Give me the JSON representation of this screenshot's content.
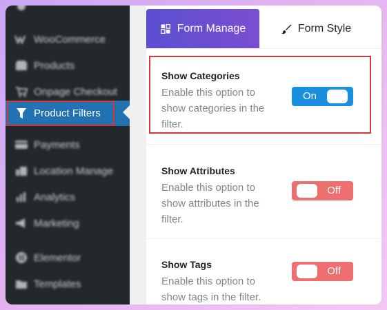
{
  "colors": {
    "frame_gradient_start": "#c9a7f5",
    "frame_gradient_end": "#f3c8f4",
    "sidebar_bg": "#23282d",
    "active_menu_bg": "#2271b1",
    "highlight_outline": "#d63638",
    "tab_active_start": "#5b4fd1",
    "tab_active_end": "#7a4fd0",
    "toggle_on": "#1a8fe0",
    "toggle_off": "#ee6f6f"
  },
  "sidebar": {
    "items": [
      {
        "label": "WooCommerce",
        "icon": "woocommerce-icon"
      },
      {
        "label": "Products",
        "icon": "box-icon"
      },
      {
        "label": "Onpage Checkout",
        "icon": "cart-icon"
      },
      {
        "label": "Product Filters",
        "icon": "filter-icon",
        "active": true
      },
      {
        "label": "Payments",
        "icon": "card-icon"
      },
      {
        "label": "Location Manage",
        "icon": "location-icon"
      },
      {
        "label": "Analytics",
        "icon": "bar-chart-icon"
      },
      {
        "label": "Marketing",
        "icon": "megaphone-icon"
      },
      {
        "label": "Elementor",
        "icon": "elementor-icon"
      },
      {
        "label": "Templates",
        "icon": "folder-icon"
      }
    ]
  },
  "tabs": [
    {
      "label": "Form Manage",
      "icon": "grid-icon",
      "active": true
    },
    {
      "label": "Form Style",
      "icon": "brush-icon",
      "active": false
    }
  ],
  "settings": [
    {
      "title": "Show Categories",
      "description": "Enable this option to show categories in the filter.",
      "toggle": "On",
      "enabled": true
    },
    {
      "title": "Show Attributes",
      "description": "Enable this option to show attributes in the filter.",
      "toggle": "Off",
      "enabled": false
    },
    {
      "title": "Show Tags",
      "description": "Enable this option to show tags in the filter.",
      "toggle": "Off",
      "enabled": false
    }
  ]
}
